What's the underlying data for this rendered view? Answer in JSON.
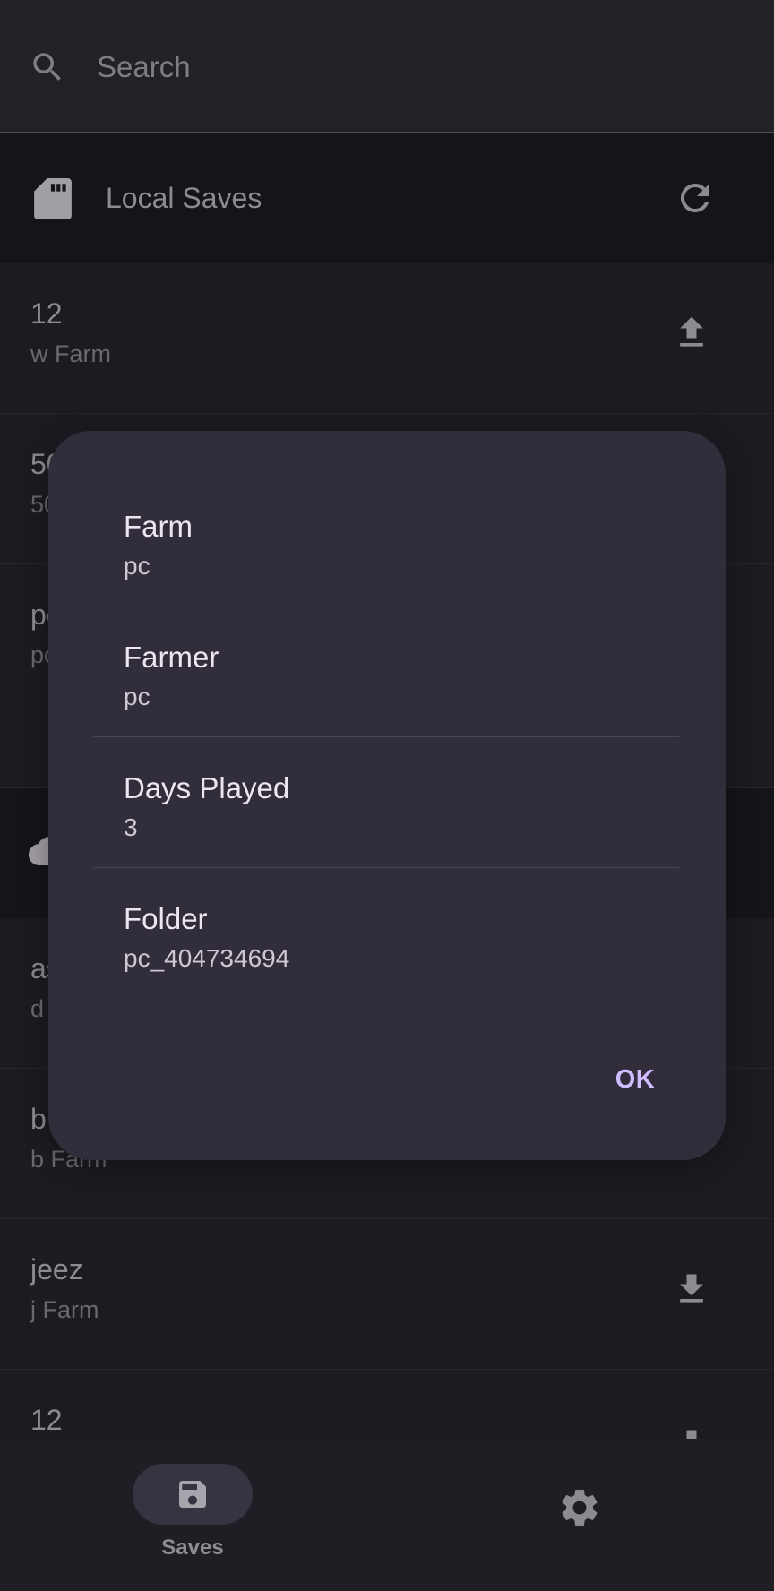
{
  "search": {
    "placeholder": "Search",
    "icon": "search-icon"
  },
  "local_saves": {
    "title": "Local Saves",
    "icon": "sd-card-icon",
    "action_icon": "refresh-icon",
    "rows": [
      {
        "primary": "12",
        "secondary": "w Farm",
        "action_icon": "upload-icon"
      },
      {
        "primary": "50",
        "secondary": "50",
        "action_icon": "upload-icon"
      },
      {
        "primary": "pc",
        "secondary": "pc",
        "action_icon": "upload-icon"
      }
    ]
  },
  "cloud_saves": {
    "title": "",
    "icon": "cloud-icon",
    "rows": [
      {
        "primary": "as",
        "secondary": "d",
        "action_icon": "download-icon"
      },
      {
        "primary": "b",
        "secondary": "b Farm",
        "action_icon": "download-icon"
      },
      {
        "primary": "jeez",
        "secondary": "j Farm",
        "action_icon": "download-icon"
      },
      {
        "primary": "12",
        "secondary": "",
        "action_icon": "download-icon"
      }
    ]
  },
  "dialog": {
    "fields": [
      {
        "label": "Farm",
        "value": "pc"
      },
      {
        "label": "Farmer",
        "value": "pc"
      },
      {
        "label": "Days Played",
        "value": "3"
      },
      {
        "label": "Folder",
        "value": "pc_404734694"
      }
    ],
    "ok_label": "OK"
  },
  "bottom_nav": {
    "saves_label": "Saves",
    "saves_icon": "save-icon",
    "settings_icon": "gear-icon"
  },
  "colors": {
    "background": "#27252d",
    "dialog": "#322d3b",
    "accent": "#d0bcff",
    "nav_pill": "#4a4556"
  }
}
